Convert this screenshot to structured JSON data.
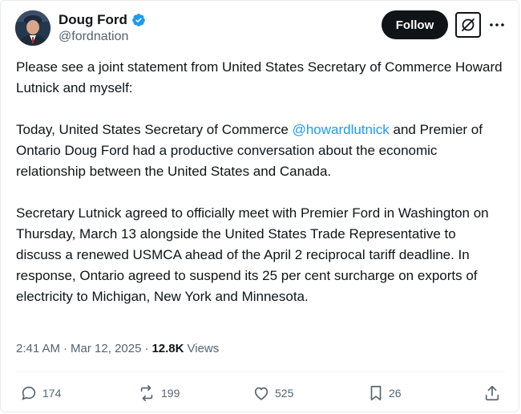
{
  "author": {
    "display_name": "Doug Ford",
    "handle": "@fordnation",
    "verified": true
  },
  "actions": {
    "follow_label": "Follow",
    "grok_icon": "grok-icon",
    "more_icon": "more-icon"
  },
  "post": {
    "intro": "Please see a joint statement from United States Secretary of Commerce Howard Lutnick and myself:",
    "p2_before": "Today, United States Secretary of Commerce ",
    "p2_mention": "@howardlutnick",
    "p2_after": " and Premier of Ontario Doug Ford had a productive conversation about the economic relationship between the United States and Canada.",
    "p3": "Secretary Lutnick agreed to officially meet with Premier Ford in Washington on Thursday, March 13 alongside the United States Trade Representative to discuss a renewed USMCA ahead of the April 2 reciprocal tariff deadline. In response, Ontario agreed to suspend its 25 per cent surcharge on exports of electricity to Michigan, New York and Minnesota."
  },
  "meta": {
    "time": "2:41 AM",
    "separator": "·",
    "date": "Mar 12, 2025",
    "dot": "·",
    "views_count": "12.8K",
    "views_label": "Views"
  },
  "engagement": {
    "replies": "174",
    "reposts": "199",
    "likes": "525",
    "bookmarks": "26"
  },
  "colors": {
    "accent": "#1d9bf0",
    "text": "#0f1419",
    "secondary": "#536471",
    "follow_bg": "#0f1419"
  }
}
